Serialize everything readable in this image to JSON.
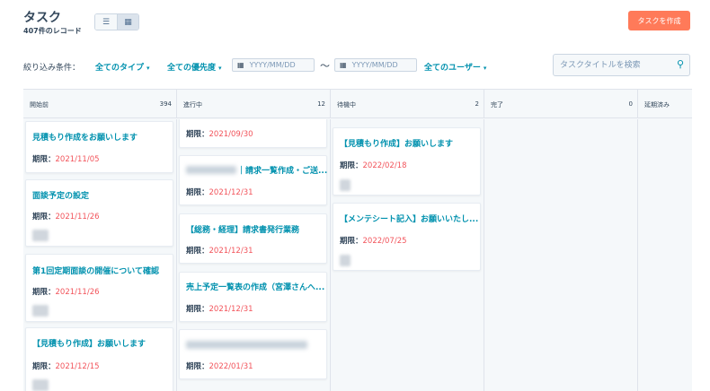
{
  "header": {
    "title": "タスク",
    "record_count": "407件のレコード",
    "create_button": "タスクを作成",
    "list_view_icon": "list-view-icon",
    "board_view_icon": "board-view-icon"
  },
  "filters": {
    "label": "絞り込み条件：",
    "type": "全てのタイプ",
    "priority": "全ての優先度",
    "date_from_placeholder": "YYYY/MM/DD",
    "tilde": "〜",
    "date_to_placeholder": "YYYY/MM/DD",
    "users": "全てのユーザー",
    "search_placeholder": "タスクタイトルを検索"
  },
  "columns": [
    {
      "name": "開始前",
      "count": "394"
    },
    {
      "name": "進行中",
      "count": "12"
    },
    {
      "name": "待機中",
      "count": "2"
    },
    {
      "name": "完了",
      "count": "0"
    },
    {
      "name": "延期済み",
      "count": ""
    }
  ],
  "due_label": "期限：",
  "cards": {
    "todo": [
      {
        "title": "見積もり作成をお願いします",
        "due": "2021/11/05"
      },
      {
        "title": "面談予定の設定",
        "due": "2021/11/26"
      },
      {
        "title": "第1回定期面談の開催について確認",
        "due": "2021/11/26"
      },
      {
        "title": "【見積もり作成】お願いします",
        "due": "2021/12/15"
      }
    ],
    "in_progress": [
      {
        "title": "",
        "due": "2021/09/30"
      },
      {
        "title": "｜請求一覧作成・ご送...",
        "due": "2021/12/31"
      },
      {
        "title": "【総務・経理】請求書発行業務",
        "due": "2021/12/31"
      },
      {
        "title": "売上予定一覧表の作成（宮澤さんへ...",
        "due": "2021/12/31"
      },
      {
        "title": "",
        "due": "2022/01/31"
      }
    ],
    "waiting": [
      {
        "title": "【見積もり作成】お願いします",
        "due": "2022/02/18"
      },
      {
        "title": "【メンテシート記入】お願いいたし...",
        "due": "2022/07/25"
      }
    ]
  }
}
